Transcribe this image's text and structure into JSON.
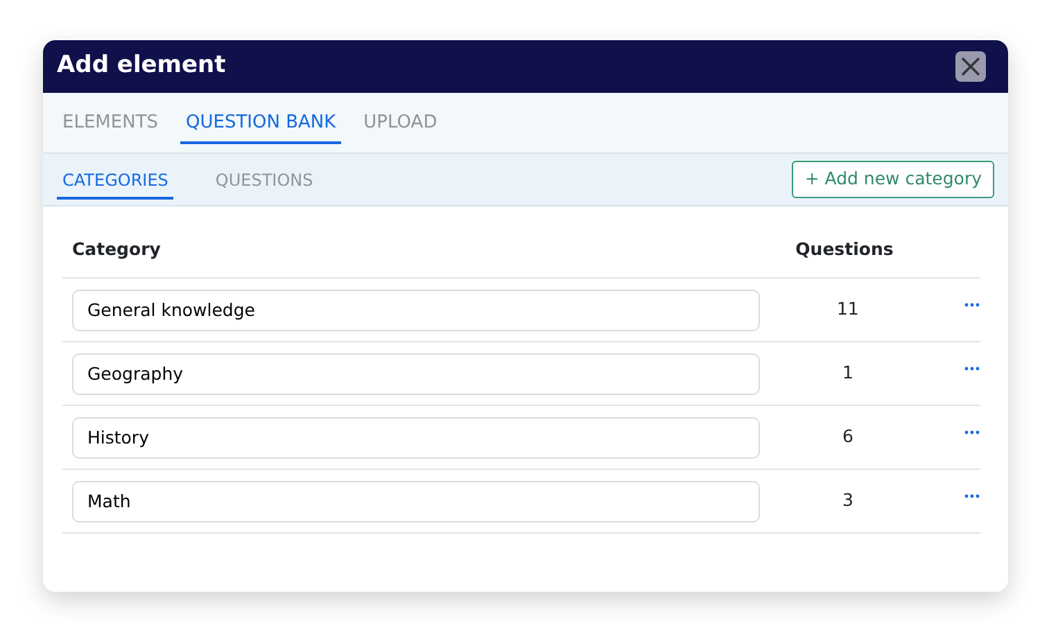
{
  "window": {
    "title": "Add element"
  },
  "tabs": [
    {
      "label": "ELEMENTS",
      "selected": false
    },
    {
      "label": "QUESTION BANK",
      "selected": true
    },
    {
      "label": "UPLOAD",
      "selected": false
    }
  ],
  "subtabs": [
    {
      "label": "CATEGORIES",
      "selected": true
    },
    {
      "label": "QUESTIONS",
      "selected": false
    }
  ],
  "add_button": "+ Add new category",
  "table": {
    "columns": [
      "Category",
      "Questions"
    ],
    "rows": [
      {
        "category": "General knowledge",
        "questions": "11"
      },
      {
        "category": "Geography",
        "questions": "1"
      },
      {
        "category": "History",
        "questions": "6"
      },
      {
        "category": "Math",
        "questions": "3"
      }
    ]
  }
}
